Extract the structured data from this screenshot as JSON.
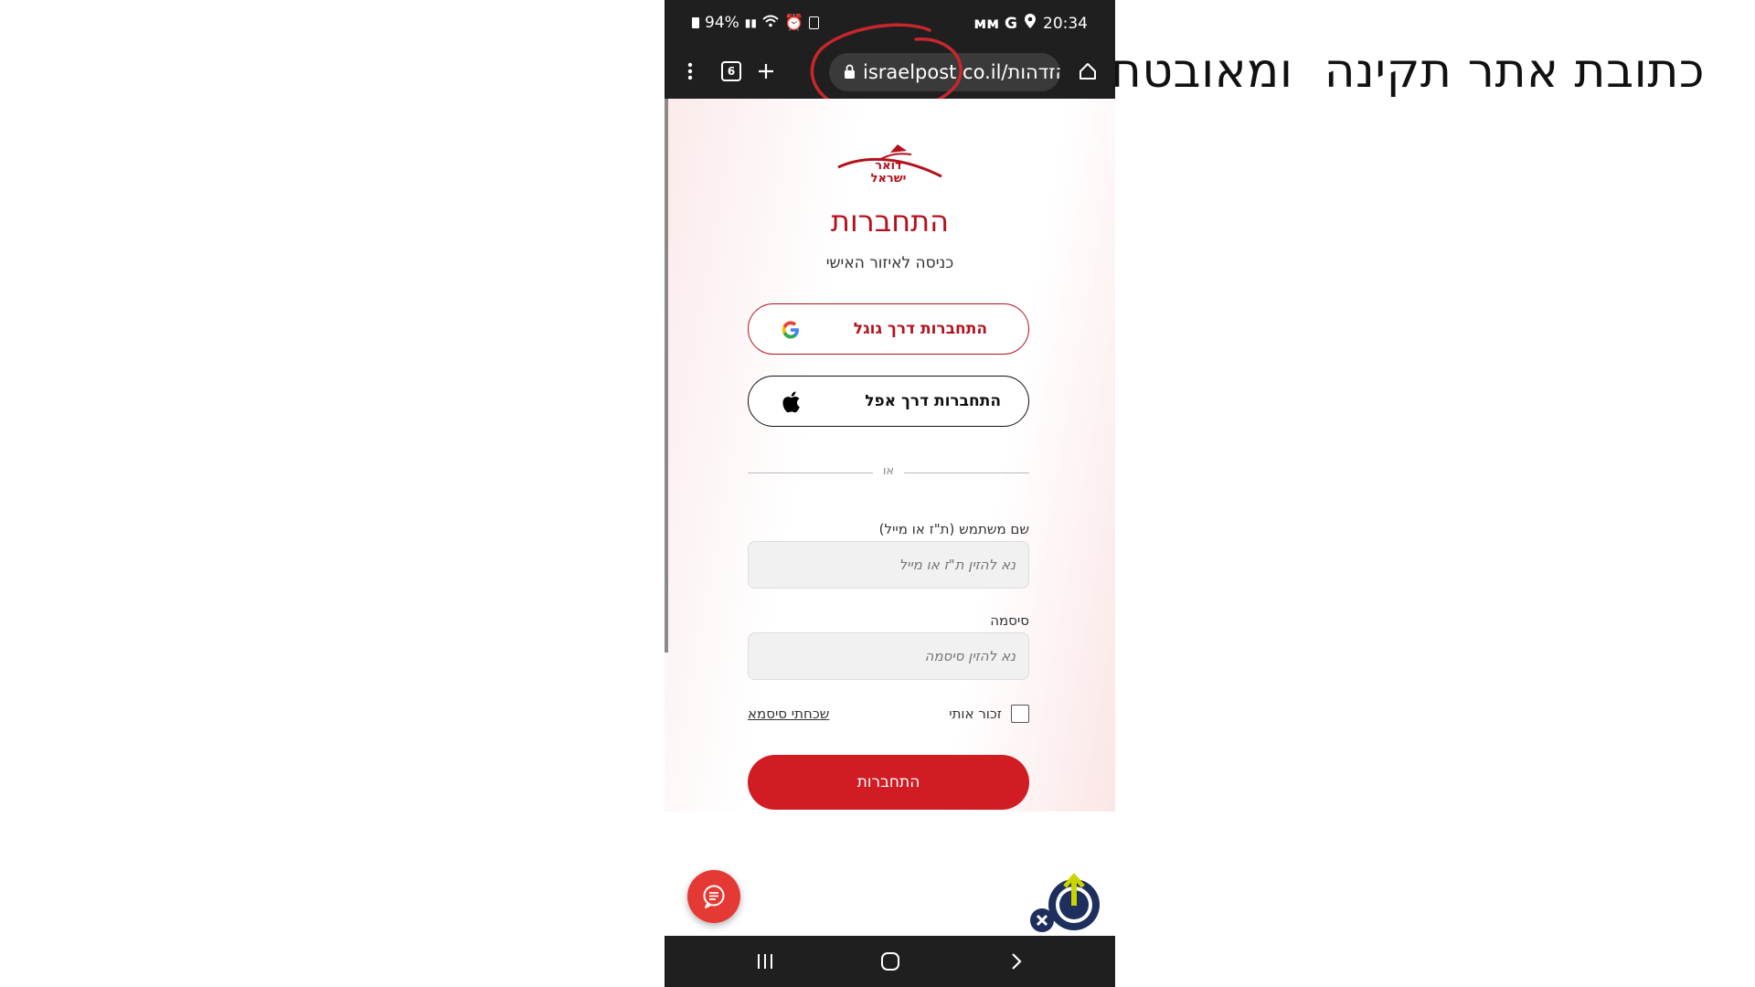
{
  "caption": "כתובת אתר תקינה  ומאובטחת",
  "statusbar": {
    "battery": "94%",
    "time": "20:34",
    "right_icons": "ᴍᴍ G"
  },
  "browser": {
    "tabs_count": "6",
    "url": "israelpost.co.il/הזדהות"
  },
  "login": {
    "logo_text_top": "דואר",
    "logo_text_bottom": "ישראל",
    "title": "התחברות",
    "subtitle": "כניסה לאיזור האישי",
    "google_label": "התחברות דרך גוגל",
    "apple_label": "התחברות דרך אפל",
    "or_label": "או",
    "username_label": "שם משתמש (ת\"ז או מייל)",
    "username_placeholder": "נא להזין ת\"ז או מייל",
    "password_label": "סיסמה",
    "password_placeholder": "נא להזין סיסמה",
    "remember_label": "זכור אותי",
    "forgot_label": "שכחתי סיסמא",
    "submit_label": "התחברות"
  },
  "colors": {
    "brand_red": "#d01c22",
    "dark_red": "#b3121d",
    "annotation_circle": "#c8262c"
  }
}
